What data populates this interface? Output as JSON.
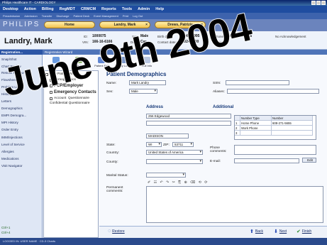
{
  "window": {
    "title": "Philips Healthcare IT - CARDIOLOGY"
  },
  "menu": [
    "Desktop",
    "Action",
    "Billing",
    "RegMDT",
    "CRMCM",
    "Reports",
    "Tools",
    "Admin",
    "Help"
  ],
  "toolbar": [
    "Preadmission",
    "Admission",
    "Transfer",
    "Discharge",
    "Patient Deck",
    "Event Management",
    "Print",
    "Log Out"
  ],
  "brand": "PHILIPS",
  "tabs": [
    {
      "label": "Home",
      "closable": false
    },
    {
      "label": "Landry, Mark",
      "closable": true
    },
    {
      "label": "Drews, Patrizia",
      "closable": true
    }
  ],
  "patient": {
    "name": "Landry, Mark",
    "id_label": "ID:",
    "id": "1000075",
    "vin_label": "VIN:",
    "vin": "166-16-6166",
    "sex_label": "Sex:",
    "sex": "Male",
    "dept_label": "Dept:",
    "dept": "Car",
    "birth_label": "Birth date:",
    "birth": "4/4/1995",
    "contact_label": "Contact date:",
    "contact": "3/24/2000",
    "phone_label": "Phone(h):",
    "phone": "608-273-5655",
    "notices_label": "Notices:",
    "ack": "No Acknowledgement"
  },
  "nav": {
    "header": "Registration...",
    "items": [
      "Snap/Shot",
      "Chart Review",
      "Results Review",
      "Flowsheets",
      "Problem List",
      "History",
      "Letters",
      "Demographics",
      "EMPI Demogra...",
      "MPI History",
      "Order Entry",
      "IMM/Injections",
      "Level of Service",
      "Allergies",
      "Medications",
      "Visit Navigator"
    ],
    "footer": [
      "Ctrl+1",
      "Ctrl+4"
    ]
  },
  "wizard": {
    "header": "Registration Wizard",
    "toolbar": [
      "PCP",
      "Audit Trail",
      "Patient FYI",
      "Family Lookup",
      "Refresh",
      "Pull Info"
    ],
    "steps": [
      "New Patient Wizard",
      "Demographics",
      "PCP/Employer",
      "Emergency Contacts",
      "Account",
      "Questionnaire",
      "Confidential Questionnaire"
    ]
  },
  "form": {
    "title": "Patient Demographics",
    "name_label": "Name:",
    "name_value": "Mark Landry",
    "sex_label": "Sex:",
    "sex_value": "Male",
    "ssn_label": "SSN:",
    "aliases_label": "Aliases:",
    "address_section": "Address",
    "address_value": "256 Edgewood",
    "city_value": "MADISON",
    "state_label": "State:",
    "state_value": "WI",
    "zip_label": "ZIP:",
    "zip_value": "53711",
    "country_label": "Country:",
    "country_value": "United States of America",
    "county_label": "County:",
    "phone_comments_label": "Phone comments:",
    "email_label": "E-mail:",
    "edit_label": "Edit",
    "additional_section": "Additional",
    "phone_grid": {
      "headers": [
        "",
        "Number Type",
        "Number"
      ],
      "rows": [
        [
          "1",
          "Home Phone",
          "608-271-5655"
        ],
        [
          "2",
          "Work Phone",
          ""
        ],
        [
          "3",
          "",
          ""
        ]
      ]
    },
    "marital_label": "Marital Status:",
    "permanent_label": "Permanent comments:"
  },
  "bottom": {
    "restore": "Restore",
    "back": "Back",
    "next": "Next",
    "finish": "Finish"
  },
  "status": {
    "text": "LOGGED IN: USER NAME   ·   CD-3 Charts"
  },
  "stamp": {
    "text": "June 9th 2004"
  },
  "colors": {
    "menu": "#1f4da0",
    "brand_row": "#6b84bd",
    "tab": "#f1c04b",
    "accent": "#173a7a"
  }
}
